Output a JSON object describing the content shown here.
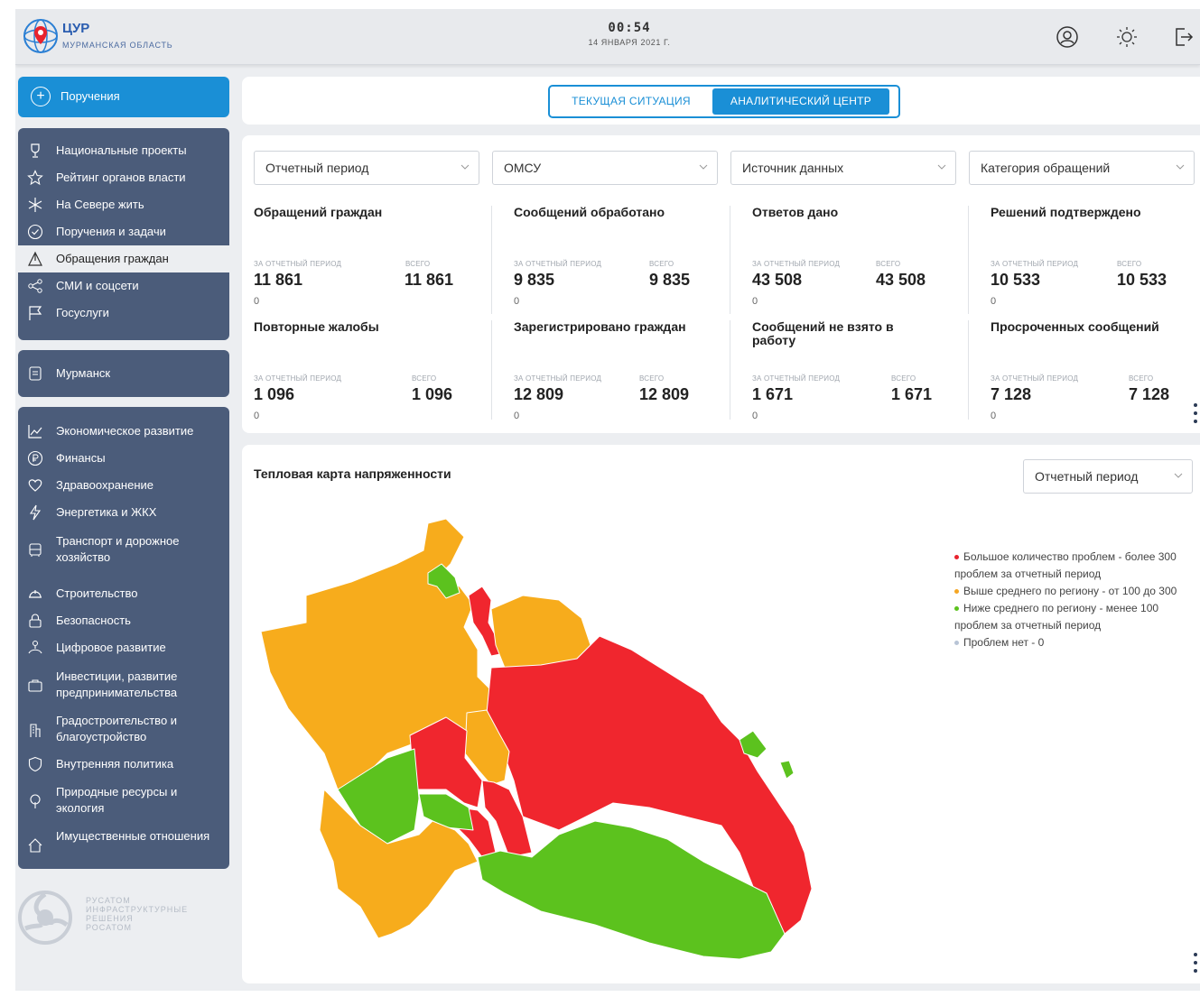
{
  "header": {
    "logo_title": "ЦУР",
    "logo_subtitle": "МУРМАНСКАЯ ОБЛАСТЬ",
    "time": "00:54",
    "date": "14 ЯНВАРЯ 2021 Г.",
    "icons": [
      "user-icon",
      "sun-icon",
      "logout-icon"
    ]
  },
  "sidebar": {
    "main_button": "Поручения",
    "group1": [
      {
        "label": "Национальные проекты",
        "icon": "trophy-icon"
      },
      {
        "label": "Рейтинг органов власти",
        "icon": "star-icon"
      },
      {
        "label": "На Севере жить",
        "icon": "snowflake-icon"
      },
      {
        "label": "Поручения и задачи",
        "icon": "check-circle-icon"
      },
      {
        "label": "Обращения граждан",
        "icon": "triangle-icon",
        "active": true
      },
      {
        "label": "СМИ и соцсети",
        "icon": "share-icon"
      },
      {
        "label": "Госуслуги",
        "icon": "flag-icon"
      }
    ],
    "city": "Мурманск",
    "group2": [
      {
        "label": "Экономическое развитие",
        "icon": "chart-icon"
      },
      {
        "label": "Финансы",
        "icon": "ruble-icon"
      },
      {
        "label": "Здравоохранение",
        "icon": "heart-icon"
      },
      {
        "label": "Энергетика и ЖКХ",
        "icon": "bolt-icon"
      },
      {
        "label": "Транспорт и дорожное хозяйство",
        "icon": "bus-icon"
      },
      {
        "label": "Строительство",
        "icon": "helmet-icon"
      },
      {
        "label": "Безопасность",
        "icon": "lock-icon"
      },
      {
        "label": "Цифровое развитие",
        "icon": "network-icon"
      },
      {
        "label": "Инвестиции, развитие предпринимательства",
        "icon": "briefcase-icon"
      },
      {
        "label": "Градостроительство и благоустройство",
        "icon": "building-icon"
      },
      {
        "label": "Внутренняя политика",
        "icon": "shield-icon"
      },
      {
        "label": "Природные ресурсы и экология",
        "icon": "tree-icon"
      },
      {
        "label": "Имущественные отношения",
        "icon": "house-icon"
      }
    ],
    "footer_logo_text": [
      "РУСАТОМ",
      "ИНФРАСТРУКТУРНЫЕ",
      "РЕШЕНИЯ",
      "РОСАТОМ"
    ]
  },
  "tabs": {
    "current": "ТЕКУЩАЯ СИТУАЦИЯ",
    "analytics": "АНАЛИТИЧЕСКИЙ ЦЕНТР",
    "active": "analytics"
  },
  "filters": [
    "Отчетный период",
    "ОМСУ",
    "Источник данных",
    "Категория обращений"
  ],
  "period_label": "ЗА ОТЧЕТНЫЙ ПЕРИОД",
  "total_label": "ВСЕГО",
  "stats": [
    {
      "title": "Обращений граждан",
      "period": "11 861",
      "total": "11 861",
      "delta": "0"
    },
    {
      "title": "Сообщений обработано",
      "period": "9 835",
      "total": "9 835",
      "delta": "0"
    },
    {
      "title": "Ответов дано",
      "period": "43 508",
      "total": "43 508",
      "delta": "0"
    },
    {
      "title": "Решений подтверждено",
      "period": "10 533",
      "total": "10 533",
      "delta": "0"
    },
    {
      "title": "Повторные жалобы",
      "period": "1 096",
      "total": "1 096",
      "delta": "0"
    },
    {
      "title": "Зарегистрировано граждан",
      "period": "12 809",
      "total": "12 809",
      "delta": "0"
    },
    {
      "title": "Сообщений не взято в работу",
      "period": "1 671",
      "total": "1 671",
      "delta": "0"
    },
    {
      "title": "Просроченных сообщений",
      "period": "7 128",
      "total": "7 128",
      "delta": "0"
    }
  ],
  "heatmap": {
    "title": "Тепловая карта напряженности",
    "filter": "Отчетный период",
    "legend": [
      {
        "color": "#e8232e",
        "text": "Большое количество проблем - более 300 проблем за отчетный период"
      },
      {
        "color": "#f5a623",
        "text": "Выше среднего по региону - от 100 до 300"
      },
      {
        "color": "#5cc21e",
        "text": "Ниже среднего по региону - менее 100 проблем за отчетный период"
      },
      {
        "color": "#b8c4d6",
        "text": "Проблем нет - 0"
      }
    ]
  },
  "colors": {
    "accent": "#1a8fd6",
    "sidebar": "#4b5c7a",
    "red": "#f0262e",
    "orange": "#f7ac1c",
    "green": "#5cc21e"
  }
}
